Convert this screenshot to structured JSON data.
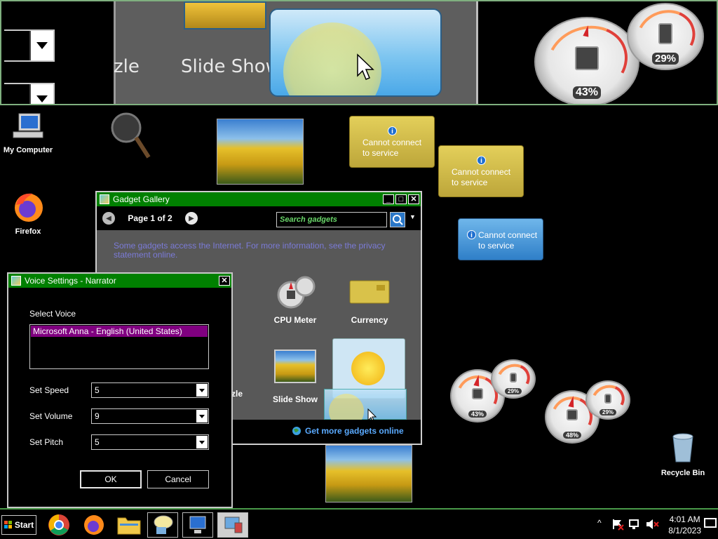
{
  "zoom": {
    "label_left": "zle",
    "label_slideshow": "Slide Show",
    "gauge_big_pct": "43%",
    "gauge_small_pct": "29%"
  },
  "desktop_icons": {
    "my_computer": "My Computer",
    "firefox": "Firefox",
    "recycle_bin": "Recycle Bin"
  },
  "currency_gadgets": [
    {
      "line1": "Cannot connect",
      "line2": "to service"
    },
    {
      "line1": "Cannot connect",
      "line2": "to service"
    },
    {
      "line1": "Cannot connect",
      "line2": "to service"
    }
  ],
  "gauges": [
    {
      "big": "43%",
      "small": "29%"
    },
    {
      "big": "48%",
      "small": "29%"
    }
  ],
  "gallery": {
    "title": "Gadget Gallery",
    "page_label": "Page 1 of 2",
    "search_placeholder": "Search gadgets",
    "notice": "Some gadgets access the Internet.  For more information, see the privacy statement online.",
    "items": {
      "cpu_meter": "CPU Meter",
      "currency": "Currency",
      "puzzle_partial": "zle",
      "slide_show": "Slide Show"
    },
    "more_link": "Get more gadgets online"
  },
  "voice_settings": {
    "title": "Voice Settings - Narrator",
    "select_voice_label": "Select Voice",
    "selected_voice": "Microsoft Anna - English (United States)",
    "speed_label": "Set Speed",
    "speed_value": "5",
    "volume_label": "Set Volume",
    "volume_value": "9",
    "pitch_label": "Set Pitch",
    "pitch_value": "5",
    "ok_label": "OK",
    "cancel_label": "Cancel"
  },
  "taskbar": {
    "start_label": "Start",
    "time": "4:01 AM",
    "date": "8/1/2023"
  },
  "colors": {
    "titlebar": "#008000",
    "selection": "#800080",
    "link": "#5aaaff"
  }
}
